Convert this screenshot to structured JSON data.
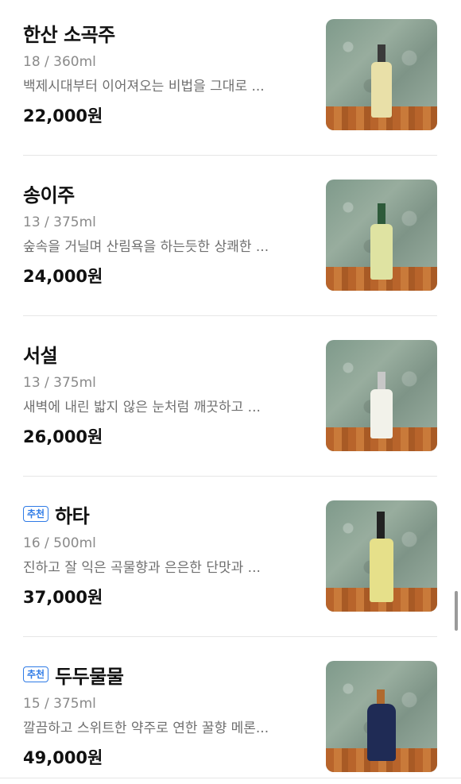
{
  "badge_label": "추천",
  "products": [
    {
      "name": "한산 소곡주",
      "spec": "18 / 360ml",
      "desc": "백제시대부터 이어져오는 비법을 그대로 ...",
      "price": "22,000원",
      "recommended": false
    },
    {
      "name": "송이주",
      "spec": "13 / 375ml",
      "desc": "숲속을 거닐며 산림욕을 하는듯한 상쾌한 ...",
      "price": "24,000원",
      "recommended": false
    },
    {
      "name": "서설",
      "spec": "13 / 375ml",
      "desc": "새벽에 내린 밟지 않은 눈처럼 깨끗하고 ...",
      "price": "26,000원",
      "recommended": false
    },
    {
      "name": "하타",
      "spec": "16 / 500ml",
      "desc": "진하고 잘 익은 곡물향과 은은한 단맛과 ...",
      "price": "37,000원",
      "recommended": true
    },
    {
      "name": "두두물물",
      "spec": "15 / 375ml",
      "desc": "깔끔하고 스위트한 약주로 연한 꿀향 메론...",
      "price": "49,000원",
      "recommended": true
    }
  ]
}
